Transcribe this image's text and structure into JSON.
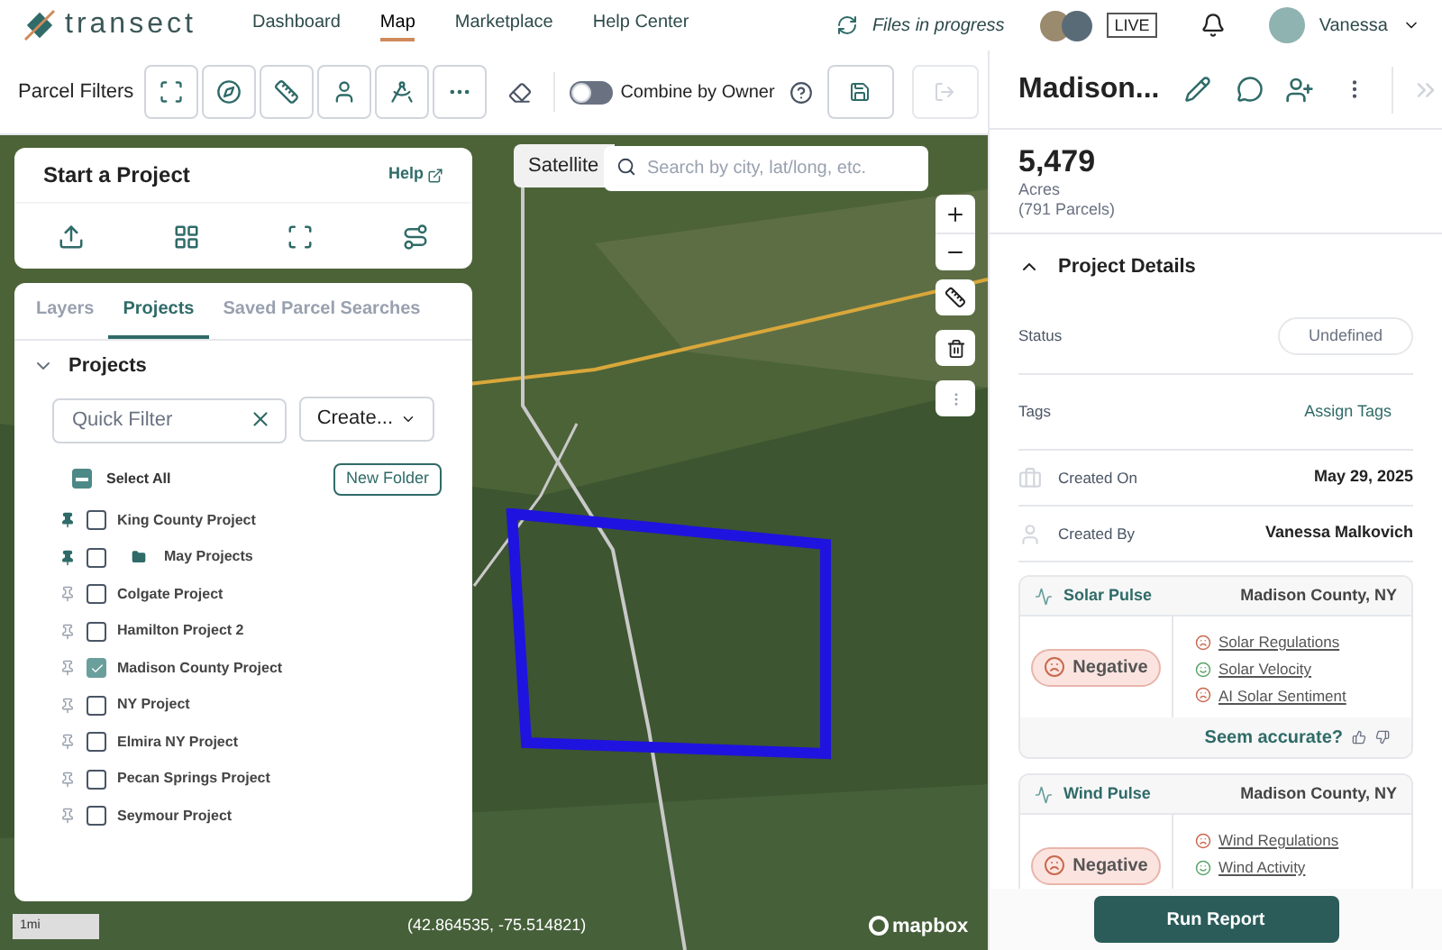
{
  "nav": {
    "logo": "transect",
    "links": [
      {
        "label": "Dashboard",
        "selected": false
      },
      {
        "label": "Map",
        "selected": true
      },
      {
        "label": "Marketplace",
        "selected": false
      },
      {
        "label": "Help Center",
        "selected": false
      }
    ],
    "files_status": "Files in progress",
    "live_badge": "LIVE",
    "user": "Vanessa"
  },
  "toolbar": {
    "label": "Parcel Filters",
    "combine": {
      "label": "Combine by Owner",
      "on": false
    },
    "export_disabled": true
  },
  "map": {
    "basemap_button": "Satellite",
    "search": {
      "placeholder": "Search by city, lat/long, etc."
    },
    "scale": "1mi",
    "coordinates": "(42.864535, -75.514821)",
    "attribution": "mapbox"
  },
  "start_project": {
    "title": "Start a Project",
    "help_link": "Help"
  },
  "projects_panel": {
    "tabs": [
      {
        "label": "Layers",
        "selected": false
      },
      {
        "label": "Projects",
        "selected": true
      },
      {
        "label": "Saved Parcel Searches",
        "selected": false
      }
    ],
    "section": {
      "title": "Projects",
      "expanded": true
    },
    "quick_filter": {
      "placeholder": "Quick Filter"
    },
    "create_button": "Create...",
    "select_all": {
      "label": "Select All",
      "indeterminate": true
    },
    "new_folder": "New Folder",
    "items": [
      {
        "name": "King County Project",
        "kind": "project",
        "pinned": true,
        "checked": false
      },
      {
        "name": "May Projects",
        "kind": "folder",
        "pinned": true,
        "checked": false
      },
      {
        "name": "Colgate Project",
        "kind": "project",
        "pinned": false,
        "checked": false
      },
      {
        "name": "Hamilton Project 2",
        "kind": "project",
        "pinned": false,
        "checked": false
      },
      {
        "name": "Madison County Project",
        "kind": "project",
        "pinned": false,
        "checked": true
      },
      {
        "name": "NY Project",
        "kind": "project",
        "pinned": false,
        "checked": false
      },
      {
        "name": "Elmira NY Project",
        "kind": "project",
        "pinned": false,
        "checked": false
      },
      {
        "name": "Pecan Springs Project",
        "kind": "project",
        "pinned": false,
        "checked": false
      },
      {
        "name": "Seymour Project",
        "kind": "project",
        "pinned": false,
        "checked": false
      }
    ]
  },
  "detail": {
    "title": "Madison...",
    "acres": "5,479",
    "acres_label": "Acres",
    "parcels": "(791 Parcels)",
    "section": {
      "title": "Project Details",
      "expanded": true
    },
    "fields": [
      {
        "label": "Status",
        "value": "Undefined",
        "kind": "status"
      },
      {
        "label": "Tags",
        "value": "Assign Tags",
        "kind": "link"
      },
      {
        "label": "Created On",
        "value": "May 29, 2025",
        "kind": "date"
      },
      {
        "label": "Created By",
        "value": "Vanessa Malkovich",
        "kind": "person"
      }
    ],
    "pulses": [
      {
        "title": "Solar Pulse",
        "location": "Madison County, NY",
        "sentiment": "Negative",
        "factors": [
          {
            "label": "Solar Regulations",
            "kind": "negative"
          },
          {
            "label": "Solar Velocity",
            "kind": "positive"
          },
          {
            "label": "AI Solar Sentiment",
            "kind": "negative"
          }
        ],
        "feedback": "Seem accurate?"
      },
      {
        "title": "Wind Pulse",
        "location": "Madison County, NY",
        "sentiment": "Negative",
        "factors": [
          {
            "label": "Wind Regulations",
            "kind": "negative"
          },
          {
            "label": "Wind Activity",
            "kind": "positive"
          }
        ]
      }
    ],
    "run_report": "Run Report"
  }
}
